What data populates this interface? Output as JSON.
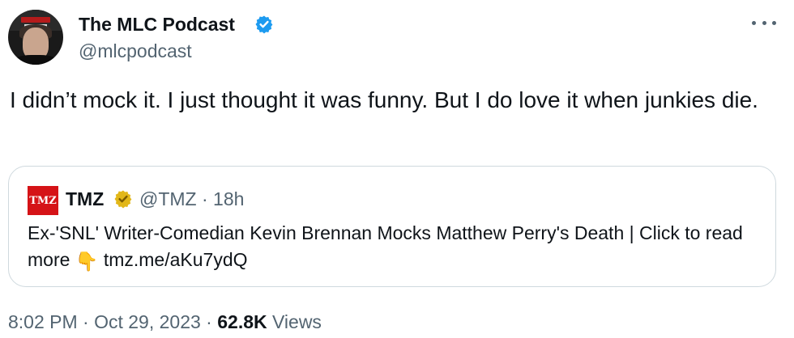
{
  "tweet": {
    "author_name": "The MLC Podcast",
    "author_handle": "@mlcpodcast",
    "verified_icon": "blue-verified-badge",
    "text": "I didn’t mock it. I just thought it was funny. But I do love it when junkies die.",
    "timestamp": "8:02 PM · Oct 29, 2023 · ",
    "views_count": "62.8K",
    "views_label": " Views"
  },
  "quote": {
    "logo_text": "TMZ",
    "author_name": "TMZ",
    "verified_icon": "gold-verified-badge",
    "author_handle": "@TMZ · 18h",
    "text_main": "Ex-'SNL' Writer-Comedian Kevin Brennan Mocks Matthew Perry's Death  |  Click to read more ",
    "emoji": "👇",
    "link": " tmz.me/aKu7ydQ"
  },
  "colors": {
    "text": "#0f1419",
    "secondary": "#536471",
    "verified_blue": "#1d9bf0",
    "verified_gold": "#e2b719",
    "card_border": "#cfd9de",
    "tmz_red": "#d51317"
  }
}
